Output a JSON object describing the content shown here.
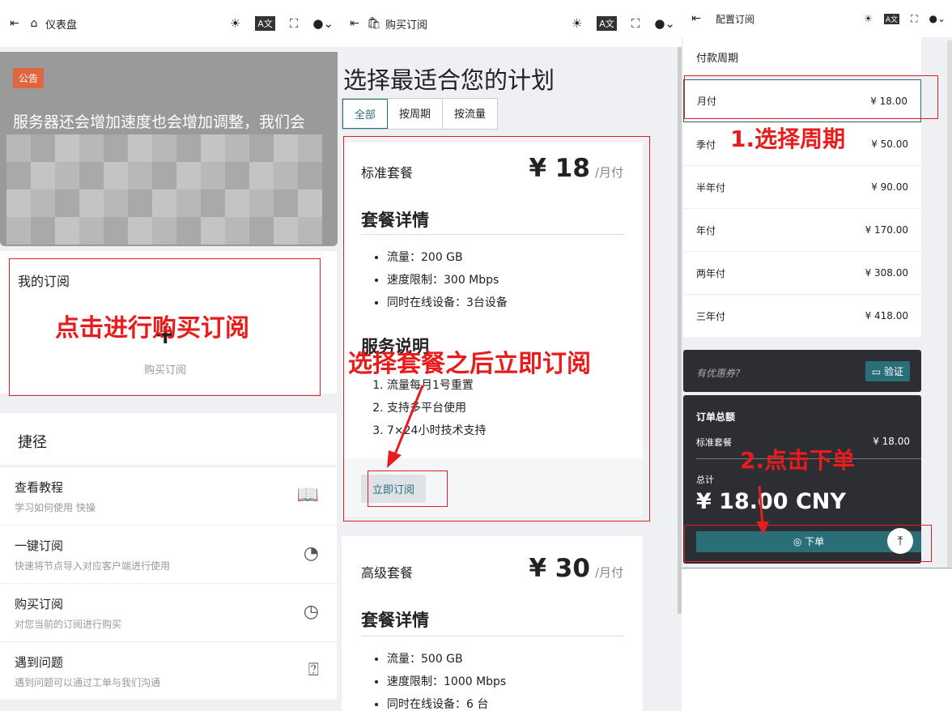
{
  "dashboard": {
    "title": "仪表盘",
    "announcement_badge": "公告",
    "announcement_text": "服务器还会增加速度也会增加调整，我们会",
    "subscription_title": "我的订阅",
    "subscription_button": "购买订阅",
    "annotation": "点击进行购买订阅",
    "shortcuts_title": "捷径",
    "shortcuts": [
      {
        "title": "查看教程",
        "subtitle": "学习如何使用 快操",
        "icon": "book-icon"
      },
      {
        "title": "一键订阅",
        "subtitle": "快速将节点导入对应客户端进行使用",
        "icon": "rss-icon"
      },
      {
        "title": "购买订阅",
        "subtitle": "对您当前的订阅进行购买",
        "icon": "clock-icon"
      },
      {
        "title": "遇到问题",
        "subtitle": "遇到问题可以通过工单与我们沟通",
        "icon": "help-chat-icon"
      }
    ]
  },
  "purchase": {
    "title": "购买订阅",
    "heading": "选择最适合您的计划",
    "tabs": [
      "全部",
      "按周期",
      "按流量"
    ],
    "annotation": "选择套餐之后立即订阅",
    "plans": [
      {
        "name": "标准套餐",
        "price": "¥ 18",
        "period": "/月付",
        "details_title": "套餐详情",
        "details": [
          "流量：200 GB",
          "速度限制：300 Mbps",
          "同时在线设备：3台设备"
        ],
        "service_title": "服务说明",
        "service": [
          "流量每月1号重置",
          "支持多平台使用",
          "7×24小时技术支持"
        ],
        "button": "立即订阅"
      },
      {
        "name": "高级套餐",
        "price": "¥ 30",
        "period": "/月付",
        "details_title": "套餐详情",
        "details": [
          "流量：500 GB",
          "速度限制：1000 Mbps",
          "同时在线设备：6 台"
        ]
      }
    ]
  },
  "configure": {
    "title": "配置订阅",
    "period_title": "付款周期",
    "periods": [
      {
        "label": "月付",
        "price": "¥ 18.00"
      },
      {
        "label": "季付",
        "price": "¥ 50.00"
      },
      {
        "label": "半年付",
        "price": "¥ 90.00"
      },
      {
        "label": "年付",
        "price": "¥ 170.00"
      },
      {
        "label": "两年付",
        "price": "¥ 308.00"
      },
      {
        "label": "三年付",
        "price": "¥ 418.00"
      }
    ],
    "annotation1": "1.选择周期",
    "coupon_label": "有优惠券?",
    "verify_button": "验证",
    "total_title": "订单总额",
    "line_item": "标准套餐",
    "line_price": "¥ 18.00",
    "total_label": "总计",
    "total": "¥ 18.00 CNY",
    "order_button": "下单",
    "annotation2": "2.点击下单"
  },
  "colors": {
    "accent": "#2a6f78",
    "annotation": "#e81c1c",
    "badge": "#e0663f"
  }
}
